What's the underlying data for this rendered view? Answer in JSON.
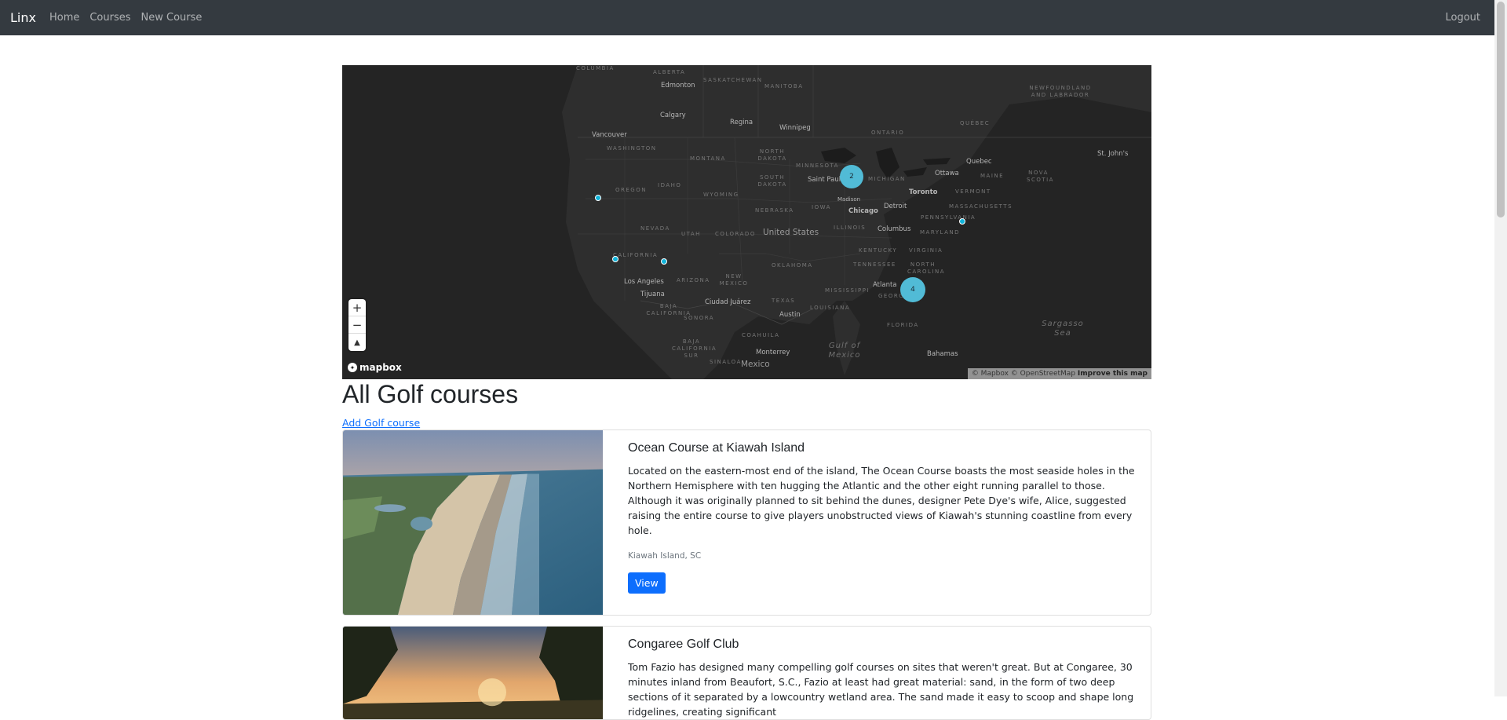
{
  "navbar": {
    "brand": "Linx",
    "links": [
      "Home",
      "Courses",
      "New Course"
    ],
    "logout": "Logout"
  },
  "map": {
    "provider": "mapbox",
    "attribution": "© Mapbox © OpenStreetMap",
    "improve": "Improve this map",
    "zoom_in": "+",
    "zoom_out": "−",
    "compass": "▲",
    "clusters": [
      "2",
      "4"
    ],
    "labels": {
      "columbia": "COLUMBIA",
      "alberta": "ALBERTA",
      "saskatchewan": "SASKATCHEWAN",
      "manitoba": "MANITOBA",
      "edmonton": "Edmonton",
      "newfoundland": "NEWFOUNDLAND AND LABRADOR",
      "calgary": "Calgary",
      "regina": "Regina",
      "winnipeg": "Winnipeg",
      "ontario": "ONTARIO",
      "quebec_prov": "QUÉBEC",
      "vancouver": "Vancouver",
      "washington": "WASHINGTON",
      "montana": "MONTANA",
      "north_dakota": "NORTH DAKOTA",
      "minnesota": "MINNESOTA",
      "quebec_city": "Quebec",
      "st_johns": "St. John's",
      "oregon": "OREGON",
      "idaho": "IDAHO",
      "south_dakota": "SOUTH DAKOTA",
      "saint_paul": "Saint Paul",
      "michigan": "MICHIGAN",
      "ottawa": "Ottawa",
      "maine": "MAINE",
      "nova_scotia": "NOVA SCOTIA",
      "wyoming": "WYOMING",
      "toronto": "Toronto",
      "vermont": "VERMONT",
      "madison": "Madison",
      "detroit": "Detroit",
      "massachusetts": "MASSACHUSETTS",
      "nebraska": "NEBRASKA",
      "iowa": "IOWA",
      "chicago": "Chicago",
      "pennsylvania": "PENNSYLVANIA",
      "nevada": "NEVADA",
      "utah": "UTAH",
      "colorado": "COLORADO",
      "united_states": "United States",
      "illinois": "ILLINOIS",
      "columbus": "Columbus",
      "maryland": "MARYLAND",
      "kentucky": "KENTUCKY",
      "virginia": "VIRGINIA",
      "california": "CALIFORNIA",
      "oklahoma": "OKLAHOMA",
      "tennessee": "TENNESSEE",
      "north_carolina": "NORTH CAROLINA",
      "los_angeles": "Los Angeles",
      "arizona": "ARIZONA",
      "new_mexico": "NEW MEXICO",
      "atlanta": "Atlanta",
      "tijuana": "Tijuana",
      "mississippi": "MISSISSIPPI",
      "georgia": "GEORGIA",
      "baja_california": "BAJA CALIFORNIA",
      "ciudad_juarez": "Ciudad Juárez",
      "texas": "TEXAS",
      "louisiana": "LOUISIANA",
      "sonora": "SONORA",
      "austin": "Austin",
      "florida": "FLORIDA",
      "sargasso": "Sargasso Sea",
      "coahuila": "COAHUILA",
      "gulf": "Gulf of Mexico",
      "baja_california_sur": "BAJA CALIFORNIA SUR",
      "monterrey": "Monterrey",
      "sinaloa": "SINALOA",
      "mexico": "Mexico",
      "bahamas": "Bahamas"
    }
  },
  "page": {
    "title": "All Golf courses",
    "add_link": "Add Golf course"
  },
  "courses": [
    {
      "name": "Ocean Course at Kiawah Island",
      "description": "Located on the eastern-most end of the island, The Ocean Course boasts the most seaside holes in the Northern Hemisphere with ten hugging the Atlantic and the other eight running parallel to those. Although it was originally planned to sit behind the dunes, designer Pete Dye's wife, Alice, suggested raising the entire course to give players unobstructed views of Kiawah's stunning coastline from every hole.",
      "location": "Kiawah Island, SC",
      "button": "View"
    },
    {
      "name": "Congaree Golf Club",
      "description": "Tom Fazio has designed many compelling golf courses on sites that weren't great. But at Congaree, 30 minutes inland from Beaufort, S.C., Fazio at least had great material: sand, in the form of two deep sections of it separated by a lowcountry wetland area. The sand made it easy to scoop and shape long ridgelines, creating significant",
      "location": "",
      "button": ""
    }
  ]
}
